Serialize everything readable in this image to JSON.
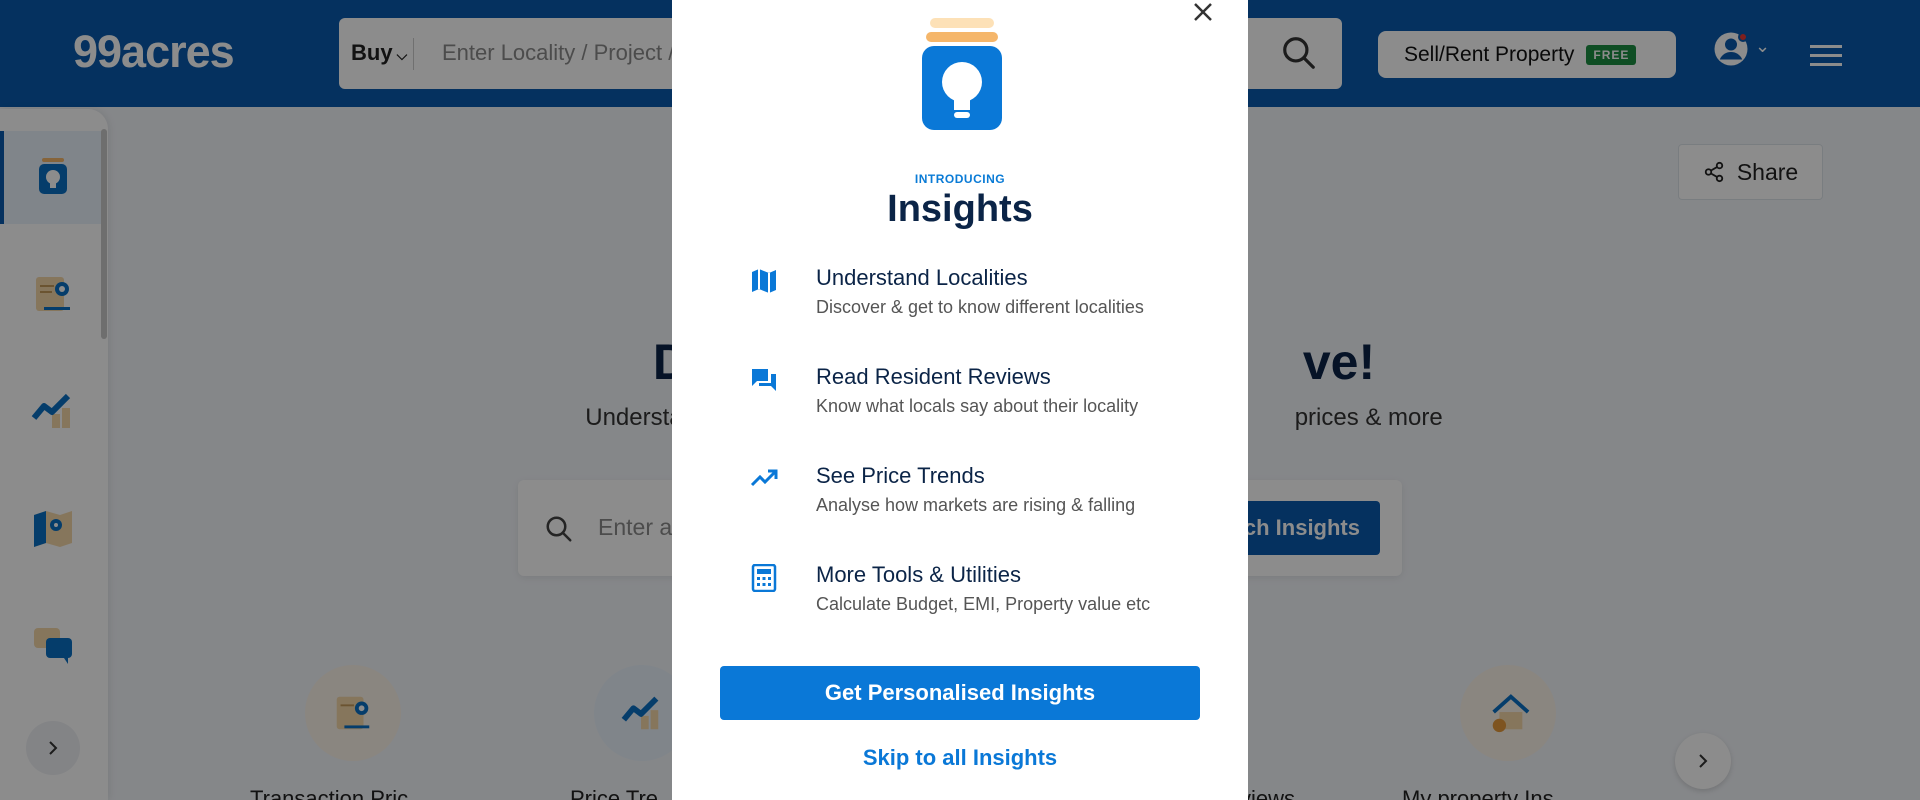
{
  "header": {
    "logo": "99acres",
    "search": {
      "type_label": "Buy",
      "placeholder": "Enter Locality / Project /"
    },
    "sell_button": {
      "label": "Sell/Rent Property",
      "badge": "FREE"
    }
  },
  "sidebar": {
    "items": [
      {
        "name": "insights",
        "icon": "lightbulb-icon",
        "active": true
      },
      {
        "name": "transaction-prices",
        "icon": "certificate-icon"
      },
      {
        "name": "price-trends",
        "icon": "trend-chart-icon"
      },
      {
        "name": "localities",
        "icon": "map-pin-icon"
      },
      {
        "name": "reviews",
        "icon": "chat-icon"
      }
    ]
  },
  "page": {
    "share_label": "Share",
    "hero_title_left": "Di",
    "hero_title_right": "ve!",
    "hero_sub_left": "Understand lo",
    "hero_sub_right": "prices & more",
    "search_placeholder": "Enter a",
    "search_cta": "ch Insights",
    "tools": [
      {
        "label": "Transaction Pric",
        "icon": "certificate-icon"
      },
      {
        "label": "Price Tre",
        "icon": "trend-chart-icon"
      },
      {
        "label": "views",
        "icon": ""
      },
      {
        "label": "My property Ins",
        "icon": "house-icon"
      }
    ]
  },
  "modal": {
    "eyebrow": "INTRODUCING",
    "title": "Insights",
    "features": [
      {
        "title": "Understand Localities",
        "desc": "Discover & get to know different localities",
        "icon": "map-icon"
      },
      {
        "title": "Read Resident Reviews",
        "desc": "Know what locals say about their locality",
        "icon": "chat-icon"
      },
      {
        "title": "See Price Trends",
        "desc": "Analyse how markets are rising & falling",
        "icon": "trend-up-icon"
      },
      {
        "title": "More Tools & Utilities",
        "desc": "Calculate Budget, EMI, Property value etc",
        "icon": "calculator-icon"
      }
    ],
    "primary_button": "Get Personalised Insights",
    "secondary_link": "Skip to all Insights"
  },
  "colors": {
    "brand": "#0a5aad",
    "accent": "#0a78d7",
    "badge_green": "#1d8f43",
    "highlight": "#f5b66a"
  }
}
